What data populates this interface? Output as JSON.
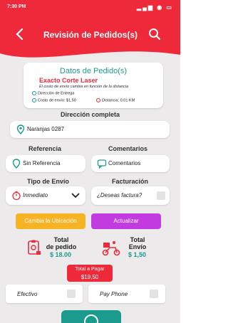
{
  "status_bar": {
    "time": "7:30 PM"
  },
  "header": {
    "title": "Revisión de Pedidos(s)"
  },
  "order_card": {
    "title": "Datos de Pedido(s)",
    "store": "Exacto Corte Laser",
    "note": "El costo de envío cambia en función de la distancia",
    "delivery_label": "Dirección de Entrega",
    "shipping_cost": "Costo de envío: $1,50",
    "distance": "Distancia: 0.01 KM"
  },
  "address": {
    "label": "Dirección completa",
    "value": "Naranjas 0287"
  },
  "reference": {
    "label": "Referencia",
    "value": "Sin Referencia"
  },
  "comments": {
    "label": "Comentarios",
    "value": "Comentarios"
  },
  "shipping_type": {
    "label": "Tipo de Envío",
    "value": "Inmediato"
  },
  "billing": {
    "label": "Facturación",
    "value": "¿Deseas factura?"
  },
  "buttons": {
    "change_location": "Cambia la Ubicación",
    "update": "Actualizar"
  },
  "totals": {
    "order_label_1": "Total",
    "order_label_2": "de pedido",
    "order_value": "$ 18.00",
    "shipping_label_1": "Total",
    "shipping_label_2": "Envío",
    "shipping_value": "$ 1,50",
    "grand_label": "Total a Pagar",
    "grand_value": "$19,50"
  },
  "payment": {
    "cash": "Efectivo",
    "payphone": "Pay Phone"
  },
  "colors": {
    "primary": "#ee2a3a",
    "teal": "#1a9b8e",
    "orange": "#f6b323",
    "purple": "#c13be0",
    "background": "#eceaea"
  }
}
